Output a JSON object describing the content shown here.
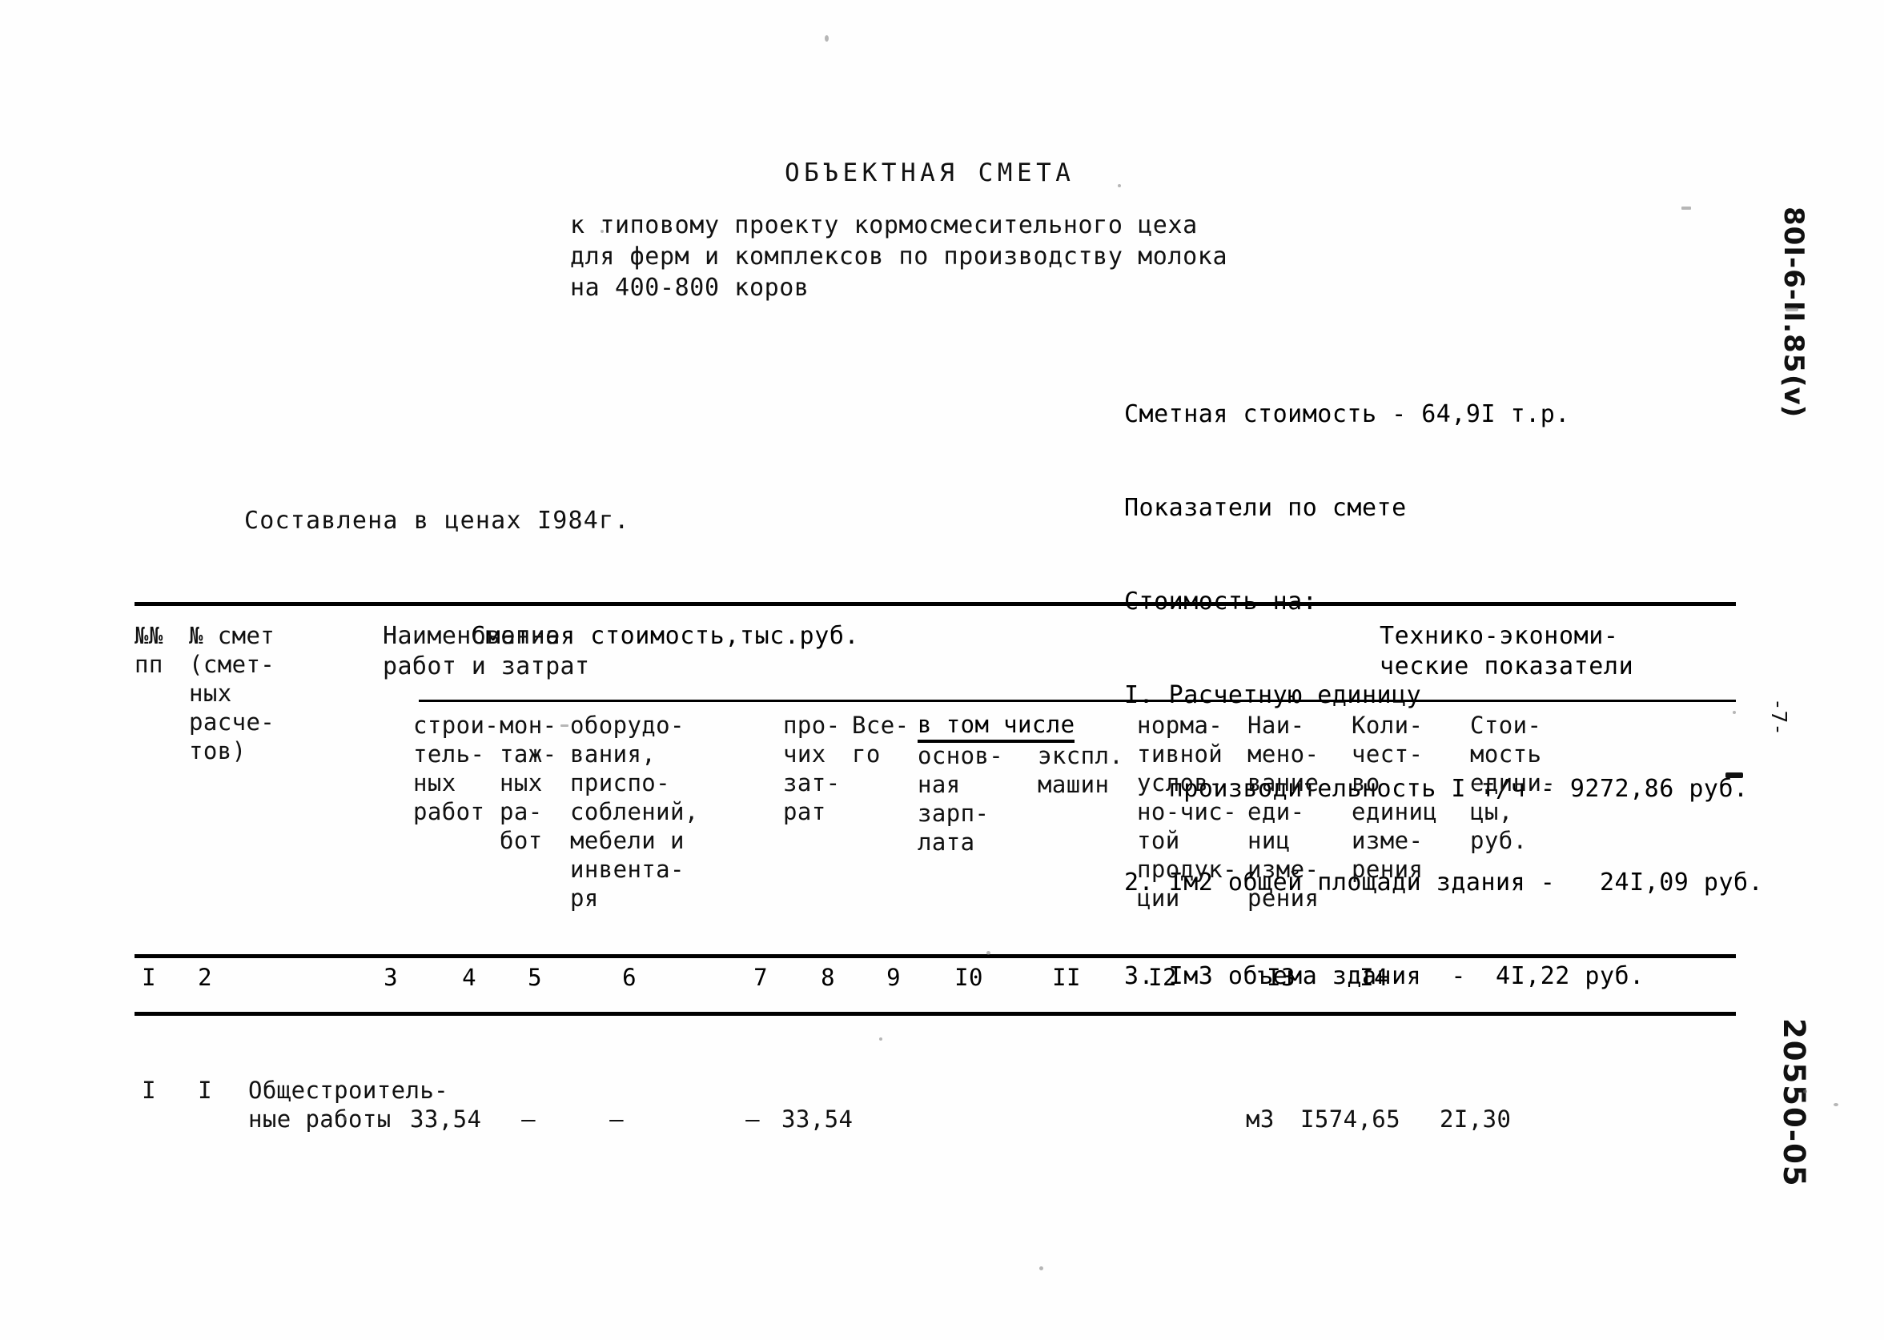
{
  "document": {
    "title": "ОБЪЕКТНАЯ СМЕТА",
    "subtitle": "к типовому проекту кормосмесительного цеха\nдля ферм и комплексов по производству молока\nна 400-800 коров",
    "prices_note": "Составлена в ценах I984г.",
    "page_number": "-7-"
  },
  "summary": {
    "total_cost_line": "Сметная стоимость - 64,9I т.р.",
    "indicators_heading": "Показатели по смете",
    "cost_per_heading": "Стоимость на:",
    "items": [
      "I. Расчетную единицу",
      "   производительность I т/ч - 9272,86 руб.",
      "2. Iм2 общей площади здания -   24I,09 руб.",
      "3. Iм3 объема здания  -  4I,22 руб."
    ]
  },
  "margin_marks": {
    "project_code": "80I-6-II.85",
    "project_code_suffix": "(v)",
    "archive_number": "20550-05"
  },
  "table": {
    "group_headers": {
      "estimate_cost": "Сметная стоимость,тыс.руб.",
      "technical_economic": "Технико-экономи-\nческие показатели",
      "in_that_number_label": "в том числе"
    },
    "headers": [
      "№№\nпп",
      "№ смет\n(смет-\nных\nрасче-\nтов)",
      "Наименование\nработ и затрат",
      "строи-\nтель-\nных\nработ",
      "мон-\nтаж-\nных\nра-\nбот",
      "оборудо-\nвания,\nприспо-\nсоблений,\nмебели и\nинвента-\nря",
      "про-\nчих\nзат-\nрат",
      "Все-\nго",
      "основ-\nная\nзарп-\nлата",
      "экспл.\nмашин",
      "норма-\nтивной\nуслов-\nно-чис-\nтой\nпродук-\nции",
      "Наи-\nмено-\nвание\nеди-\nниц\nизме-\nрения",
      "Коли-\nчест-\nво\nединиц\nизме-\nрения",
      "Стои-\nмость\nедини-\nцы,\nруб."
    ],
    "column_numbers": [
      "I",
      "2",
      "3",
      "4",
      "5",
      "6",
      "7",
      "8",
      "9",
      "I0",
      "II",
      "I2",
      "I3",
      "I4"
    ],
    "rows": [
      {
        "num_pp": "I",
        "estimate_no": "I",
        "name": "Общестроитель-\nные работы",
        "construction_works": "33,54",
        "assembly_works": "–",
        "equipment": "–",
        "other_costs": "–",
        "total": "33,54",
        "base_salary": "",
        "machine_operation": "",
        "normative_net_production": "",
        "unit_name": "м3",
        "unit_quantity": "I574,65",
        "unit_cost": "2I,30"
      }
    ]
  }
}
